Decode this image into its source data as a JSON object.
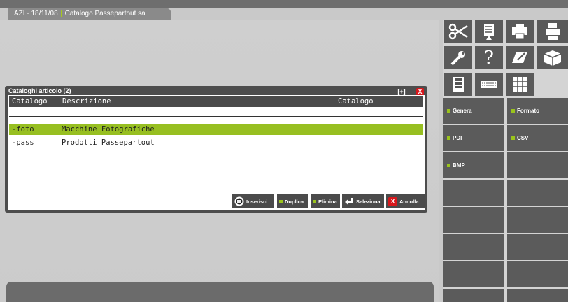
{
  "tab": {
    "company": "AZI - 18/11/08",
    "title": "Catalogo Passepartout sa"
  },
  "dialog": {
    "title": "Cataloghi articolo (2)",
    "plus_label": "[+]",
    "close_label": "X",
    "columns": [
      "Catalogo",
      "Descrizione",
      "Catalogo"
    ],
    "rows": [
      {
        "code": "-foto",
        "description": "Macchine Fotografiche",
        "selected": true
      },
      {
        "code": "-pass",
        "description": "Prodotti Passepartout",
        "selected": false
      }
    ],
    "buttons": {
      "insert": "Inserisci",
      "duplicate": "Duplica",
      "delete": "Elimina",
      "select": "Seleziona",
      "cancel": "Annulla"
    }
  },
  "toolbar": {
    "icons": [
      "scissors-icon",
      "document-icon",
      "printer-stack-icon",
      "printer-icon",
      "wrench-icon",
      "help-icon",
      "edit-document-icon",
      "package-icon",
      "calculator-icon",
      "keyboard-icon",
      "grid-icon"
    ]
  },
  "functions": {
    "genera": "Genera",
    "formato": "Formato",
    "pdf": "PDF",
    "csv": "CSV",
    "bmp": "BMP"
  },
  "colors": {
    "accent": "#97bf21",
    "close": "#d7181c",
    "panel_dark": "#5b5b5b"
  }
}
